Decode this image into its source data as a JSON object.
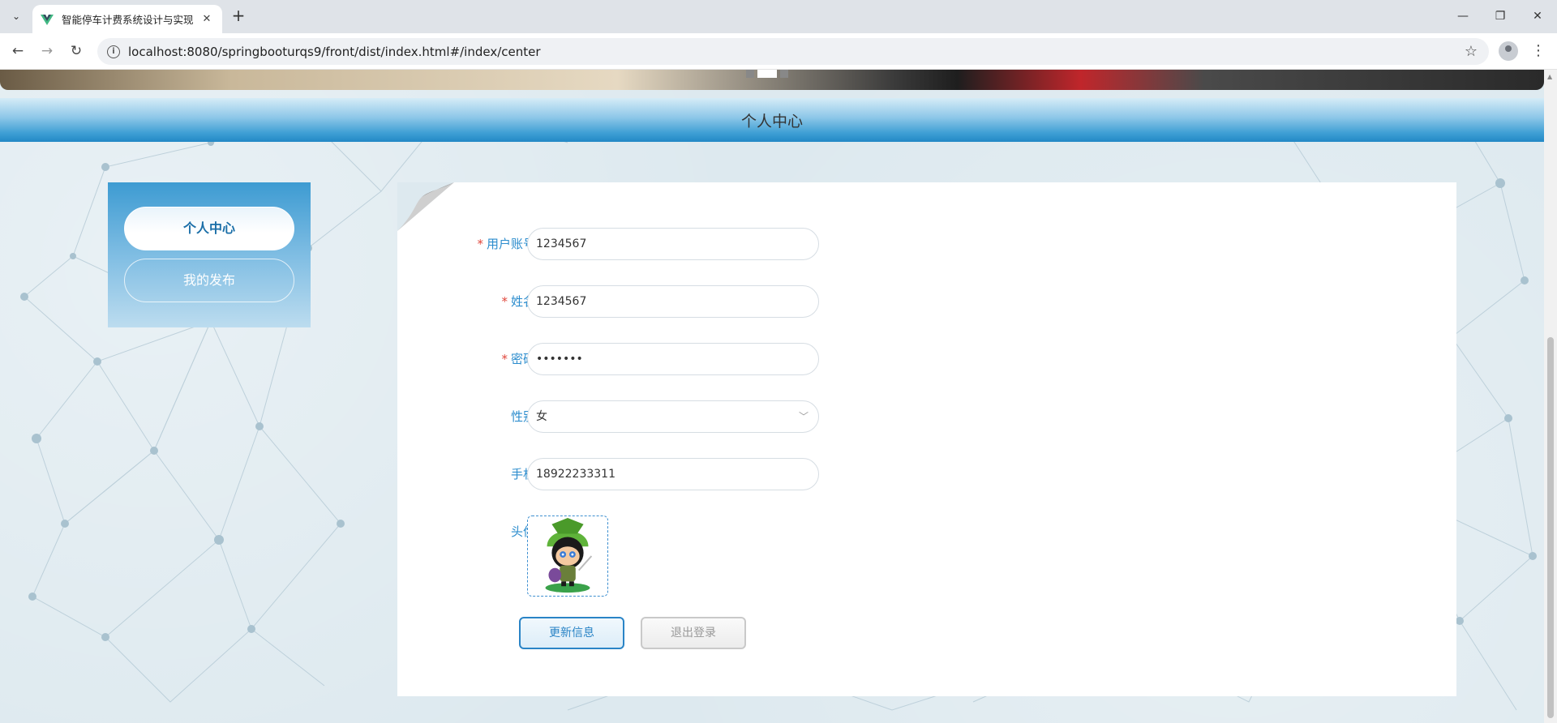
{
  "browser": {
    "tab_title": "智能停车计费系统设计与实现",
    "url": "localhost:8080/springbooturqs9/front/dist/index.html#/index/center"
  },
  "page": {
    "section_title": "个人中心"
  },
  "sidebar": {
    "items": [
      {
        "label": "个人中心",
        "active": true
      },
      {
        "label": "我的发布",
        "active": false
      }
    ]
  },
  "form": {
    "fields": [
      {
        "label": "用户账号",
        "required": true,
        "value": "1234567"
      },
      {
        "label": "姓名",
        "required": true,
        "value": "1234567"
      },
      {
        "label": "密码",
        "required": true,
        "value": "•••••••"
      },
      {
        "label": "性别",
        "required": false,
        "value": "女"
      },
      {
        "label": "手机",
        "required": false,
        "value": "18922233311"
      }
    ],
    "avatar_label": "头像",
    "update_button": "更新信息",
    "logout_button": "退出登录",
    "required_mark": "*"
  },
  "colors": {
    "accent": "#2b8ccd",
    "required": "#e0463b",
    "header_gradient_end": "#2288c6"
  },
  "carousel": {
    "active_index": 1,
    "count": 3
  }
}
